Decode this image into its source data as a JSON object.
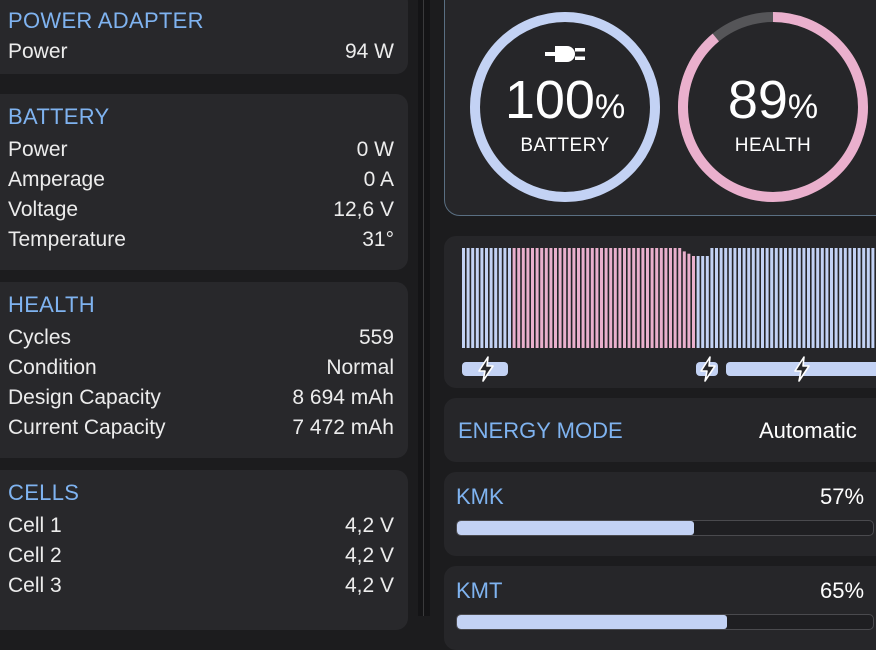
{
  "power_adapter": {
    "title": "POWER ADAPTER",
    "rows": [
      {
        "label": "Power",
        "value": "94 W"
      }
    ]
  },
  "battery": {
    "title": "BATTERY",
    "rows": [
      {
        "label": "Power",
        "value": "0 W"
      },
      {
        "label": "Amperage",
        "value": "0 A"
      },
      {
        "label": "Voltage",
        "value": "12,6 V"
      },
      {
        "label": "Temperature",
        "value": "31°"
      }
    ]
  },
  "health": {
    "title": "HEALTH",
    "rows": [
      {
        "label": "Cycles",
        "value": "559"
      },
      {
        "label": "Condition",
        "value": "Normal"
      },
      {
        "label": "Design Capacity",
        "value": "8 694 mAh"
      },
      {
        "label": "Current Capacity",
        "value": "7 472 mAh"
      }
    ]
  },
  "cells": {
    "title": "CELLS",
    "rows": [
      {
        "label": "Cell 1",
        "value": "4,2 V"
      },
      {
        "label": "Cell 2",
        "value": "4,2 V"
      },
      {
        "label": "Cell 3",
        "value": "4,2 V"
      }
    ]
  },
  "gauges": {
    "battery": {
      "value": "100",
      "unit": "%",
      "label": "BATTERY",
      "fraction": 1.0,
      "icon": "power-plug-icon",
      "color": "#c3d2f4"
    },
    "health": {
      "value": "89",
      "unit": "%",
      "label": "HEALTH",
      "fraction": 0.89,
      "color": "#eab0cd",
      "track_color": "#555558"
    }
  },
  "history": {
    "colors": {
      "charging": "#c3d2f4",
      "discharging": "#eab0cd"
    },
    "icon": "lightning-bolt-icon"
  },
  "energy_mode": {
    "title": "ENERGY MODE",
    "value": "Automatic"
  },
  "meters": [
    {
      "name": "KMK",
      "value": "57%",
      "fraction": 0.57
    },
    {
      "name": "KMT",
      "value": "65%",
      "fraction": 0.65
    }
  ]
}
